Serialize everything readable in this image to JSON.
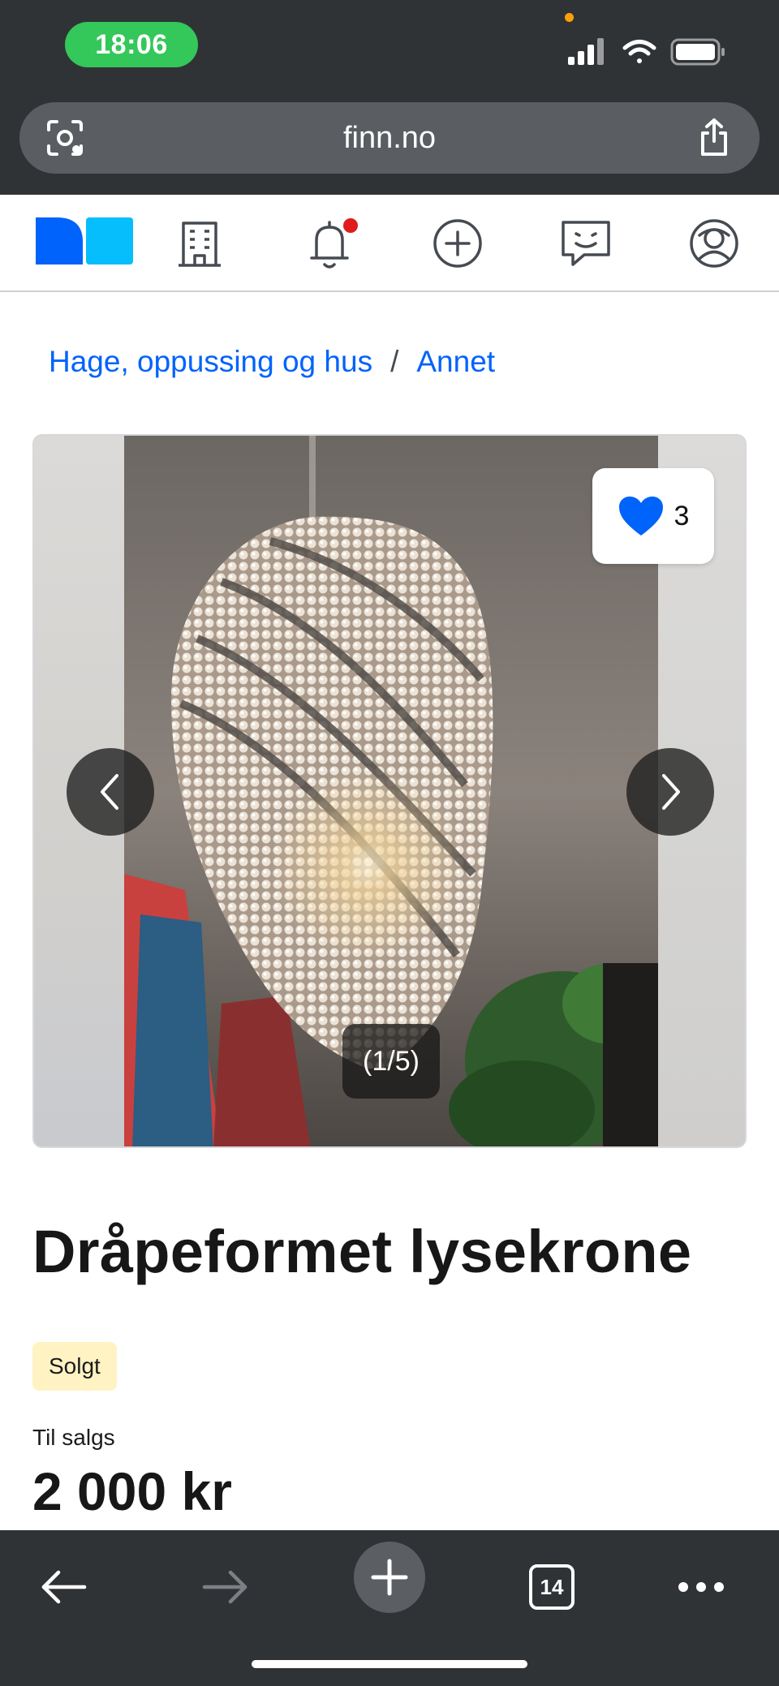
{
  "status_bar": {
    "time": "18:06",
    "time_pill_color": "#34c759"
  },
  "browser": {
    "url": "finn.no",
    "tabs_count": "14",
    "chrome_color": "#303336"
  },
  "nav": {
    "items": [
      "finn-logo",
      "building-icon",
      "bell-icon",
      "plus-circle-icon",
      "chat-icon",
      "profile-icon"
    ],
    "notification_dot_color": "#e01b1b"
  },
  "breadcrumb": {
    "items": [
      "Hage, oppussing og hus",
      "Annet"
    ],
    "separator": "/",
    "link_color": "#0063fb"
  },
  "gallery": {
    "favorites_count": "3",
    "image_counter": "(1/5)",
    "heart_color": "#0063fb"
  },
  "listing": {
    "title": "Dråpeformet lysekrone",
    "status_badge": "Solgt",
    "sale_label": "Til salgs",
    "price": "2 000 kr"
  }
}
